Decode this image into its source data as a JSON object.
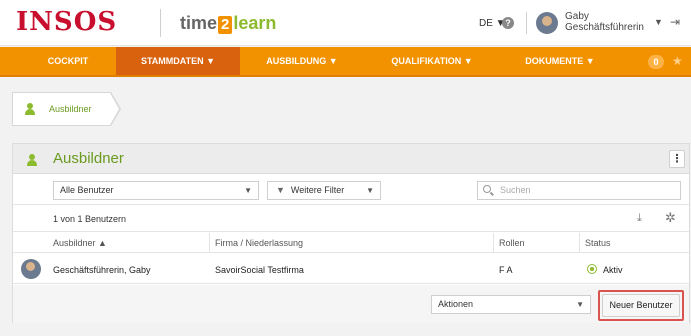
{
  "header": {
    "logo_text": "INSOS",
    "product": {
      "part1": "time",
      "part2": "2",
      "part3": "learn"
    },
    "language": "DE ▼",
    "help_icon": "question-icon",
    "user_name": "Gaby",
    "user_role": "Geschäftsführerin",
    "user_caret": "▼",
    "logout_icon": "⇥"
  },
  "nav": {
    "items": [
      {
        "label": "COCKPIT"
      },
      {
        "label": "STAMMDATEN ▼"
      },
      {
        "label": "AUSBILDUNG ▼"
      },
      {
        "label": "QUALIFIKATION ▼"
      },
      {
        "label": "DOKUMENTE ▼"
      }
    ],
    "badge": "0",
    "star": "★",
    "accent": "#f39200",
    "active_color": "#d9620f"
  },
  "breadcrumb": {
    "label": "Ausbildner"
  },
  "panel": {
    "title": "Ausbildner",
    "menu": "⋮",
    "filter_select": "Alle Benutzer",
    "more_filters": "Weitere Filter",
    "search_placeholder": "Suchen",
    "count": "1 von 1 Benutzern",
    "download_icon": "⤓",
    "settings_icon": "✲",
    "columns": {
      "trainer": "Ausbildner ▲",
      "company": "Firma / Niederlassung",
      "roles": "Rollen",
      "status": "Status"
    },
    "rows": [
      {
        "name": "Geschäftsführerin, Gaby",
        "company": "SavoirSocial Testfirma",
        "roles": "F A",
        "status": "Aktiv"
      }
    ],
    "actions_select": "Aktionen",
    "new_user_button": "Neuer Benutzer"
  }
}
